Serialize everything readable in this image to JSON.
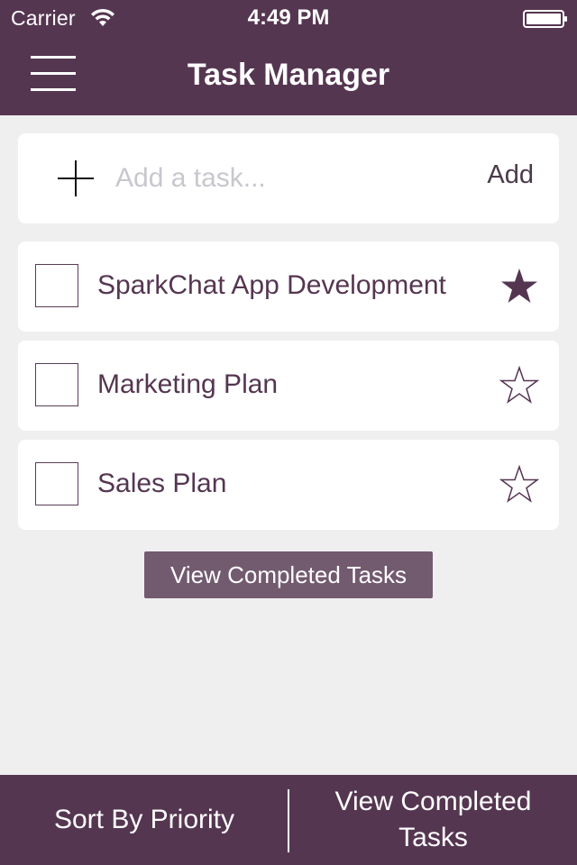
{
  "status_bar": {
    "carrier": "Carrier",
    "time": "4:49 PM"
  },
  "nav": {
    "title": "Task Manager",
    "menu_icon": "hamburger-menu-icon"
  },
  "add_task": {
    "placeholder": "Add a task...",
    "value": "",
    "button_label": "Add",
    "icon": "plus-icon"
  },
  "tasks": [
    {
      "title": "SparkChat App Development",
      "starred": true,
      "completed": false
    },
    {
      "title": "Marketing Plan",
      "starred": false,
      "completed": false
    },
    {
      "title": "Sales Plan",
      "starred": false,
      "completed": false
    }
  ],
  "view_completed_center_label": "View Completed Tasks",
  "bottom_bar": {
    "sort_label": "Sort By Priority",
    "view_completed_label": "View Completed Tasks"
  },
  "colors": {
    "brand": "#553651",
    "button": "#725a6f",
    "background": "#efeff0"
  }
}
